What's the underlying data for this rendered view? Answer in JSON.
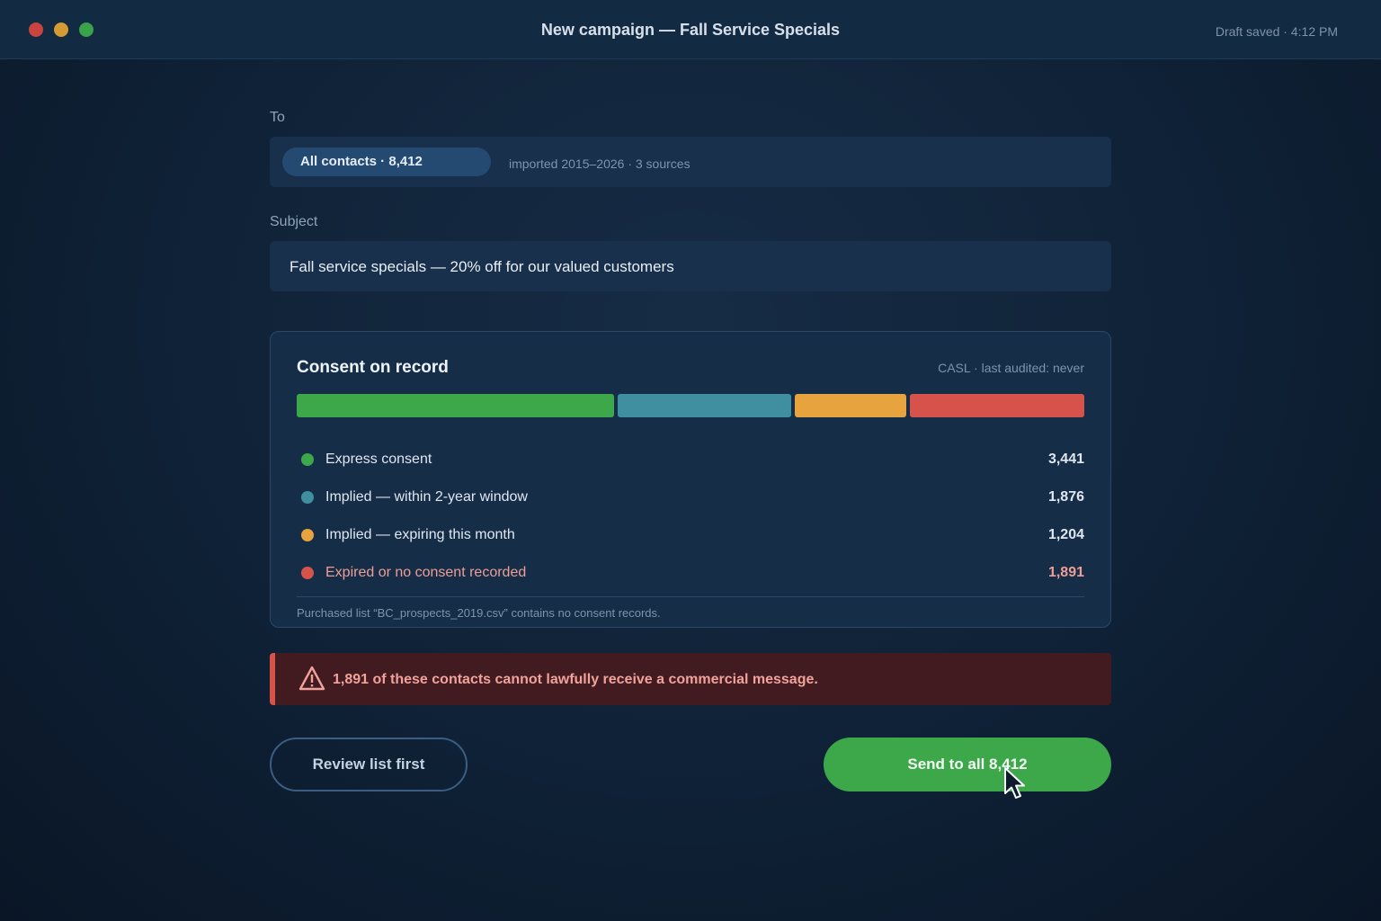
{
  "window": {
    "title": "New campaign — Fall Service Specials",
    "status": "Draft saved · 4:12 PM"
  },
  "to": {
    "label": "To",
    "chip": "All contacts · 8,412",
    "meta": "imported 2015–2026 · 3 sources"
  },
  "subject": {
    "label": "Subject",
    "value": "Fall service specials — 20% off for our valued customers"
  },
  "consent": {
    "title": "Consent on record",
    "meta": "CASL · last audited: never",
    "categories": [
      {
        "label": "Express consent",
        "count": "3,441",
        "value": 3441,
        "color": "#3da84a"
      },
      {
        "label": "Implied — within 2-year window",
        "count": "1,876",
        "value": 1876,
        "color": "#3f8fa0"
      },
      {
        "label": "Implied — expiring this month",
        "count": "1,204",
        "value": 1204,
        "color": "#e7a33e"
      },
      {
        "label": "Expired or no consent recorded",
        "count": "1,891",
        "value": 1891,
        "color": "#d6534c"
      }
    ],
    "footnote": "Purchased list “BC_prospects_2019.csv” contains no consent records."
  },
  "warning": {
    "text": "1,891 of these contacts cannot lawfully receive a commercial message.",
    "icon": "warning-triangle-icon"
  },
  "actions": {
    "review_label": "Review list first",
    "send_label": "Send to all 8,412"
  }
}
